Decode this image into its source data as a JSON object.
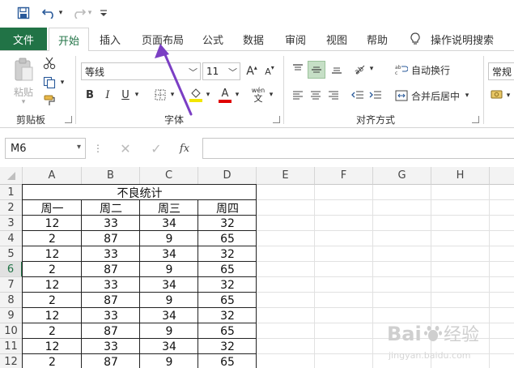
{
  "qat": {
    "save_icon": "save-icon",
    "undo_icon": "undo-icon",
    "redo_icon": "redo-icon",
    "customize_icon": "customize-qat-icon"
  },
  "tabs": {
    "file": "文件",
    "items": [
      "开始",
      "插入",
      "页面布局",
      "公式",
      "数据",
      "审阅",
      "视图",
      "帮助"
    ],
    "tell_me": "操作说明搜索"
  },
  "ribbon": {
    "clipboard": {
      "paste": "粘贴",
      "label": "剪贴板"
    },
    "font": {
      "name": "等线",
      "size": "11",
      "label": "字体",
      "bold": "B",
      "italic": "I",
      "underline": "U",
      "wen": "wén",
      "grow": "A",
      "shrink": "A",
      "font_color": "A"
    },
    "align": {
      "wrap": "自动换行",
      "merge": "合并后居中",
      "label": "对齐方式"
    },
    "number": {
      "format": "常规"
    }
  },
  "formula_bar": {
    "name_box": "M6",
    "fx": "fx",
    "value": ""
  },
  "sheet": {
    "columns": [
      "A",
      "B",
      "C",
      "D",
      "E",
      "F",
      "G",
      "H"
    ],
    "rows": [
      "1",
      "2",
      "3",
      "4",
      "5",
      "6",
      "7",
      "8",
      "9",
      "10",
      "11",
      "12"
    ],
    "title": "不良统计",
    "headers": [
      "周一",
      "周二",
      "周三",
      "周四"
    ],
    "data": [
      [
        "12",
        "33",
        "34",
        "32"
      ],
      [
        "2",
        "87",
        "9",
        "65"
      ],
      [
        "12",
        "33",
        "34",
        "32"
      ],
      [
        "2",
        "87",
        "9",
        "65"
      ],
      [
        "12",
        "33",
        "34",
        "32"
      ],
      [
        "2",
        "87",
        "9",
        "65"
      ],
      [
        "12",
        "33",
        "34",
        "32"
      ],
      [
        "2",
        "87",
        "9",
        "65"
      ],
      [
        "12",
        "33",
        "34",
        "32"
      ],
      [
        "2",
        "87",
        "9",
        "65"
      ]
    ],
    "active_row": "6"
  },
  "colors": {
    "excel_green": "#217346",
    "arrow": "#7b3fc4",
    "font_red": "#e00000",
    "fill_yellow": "#f2e600"
  }
}
